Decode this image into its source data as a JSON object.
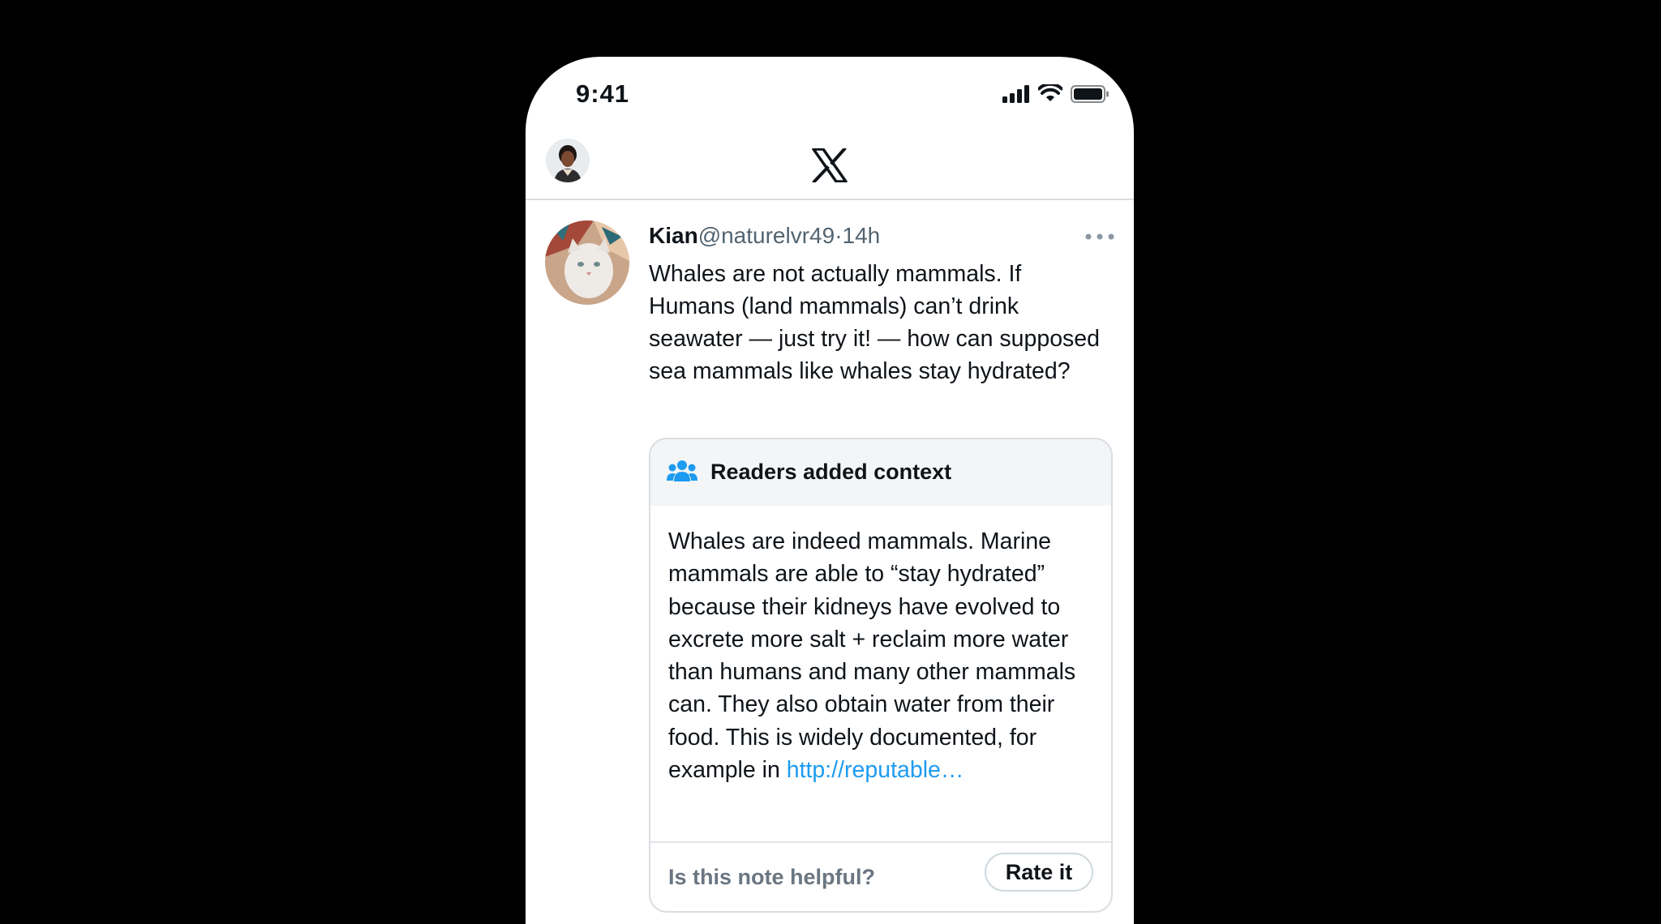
{
  "status_bar": {
    "time": "9:41",
    "icons": [
      "cellular-signal-icon",
      "wifi-icon",
      "battery-icon"
    ]
  },
  "nav": {
    "logo": "x-logo-icon"
  },
  "tweet": {
    "name": "Kian",
    "handle": "@naturelvr49",
    "separator": "·",
    "time": "14h",
    "text": "Whales are not actually mammals. If Humans (land mammals) can’t drink seawater — just try it! — how can supposed sea mammals like whales stay hydrated?"
  },
  "note": {
    "title": "Readers added context",
    "body": "Whales are indeed mammals. Marine mammals are able to “stay hydrated” because their kidneys have evolved to excrete more salt + reclaim more water than humans and many other mammals can. They also obtain water from their food. This is widely documented, for example in ",
    "link_text": "http://reputable…",
    "question": "Is this note helpful?",
    "rate_label": "Rate it"
  },
  "colors": {
    "background": "#000000",
    "card": "#ffffff",
    "text": "#0f1419",
    "secondary_text": "#536471",
    "link": "#1d9bf0",
    "note_icon": "#1d9bf0"
  }
}
